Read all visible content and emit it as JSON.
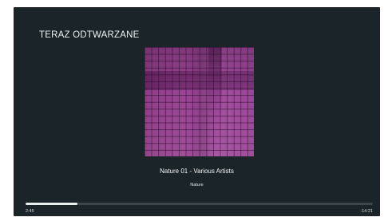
{
  "header": {
    "title": "TERAZ ODTWARZANE"
  },
  "album_art": {
    "icon": "album-cover-image",
    "colors": {
      "primary": "#9a4594",
      "grid": "#2d0a2d"
    }
  },
  "track": {
    "title": "Nature 01 - Various Artists",
    "subtitle": "Nature"
  },
  "playback": {
    "elapsed": "2:45",
    "remaining": "-14:21",
    "progress_fraction": 0.15
  },
  "colors": {
    "background": "#1b2428",
    "text": "#eef2f3",
    "progress_track": "#3d474b",
    "progress_fill": "#e9eeef"
  }
}
